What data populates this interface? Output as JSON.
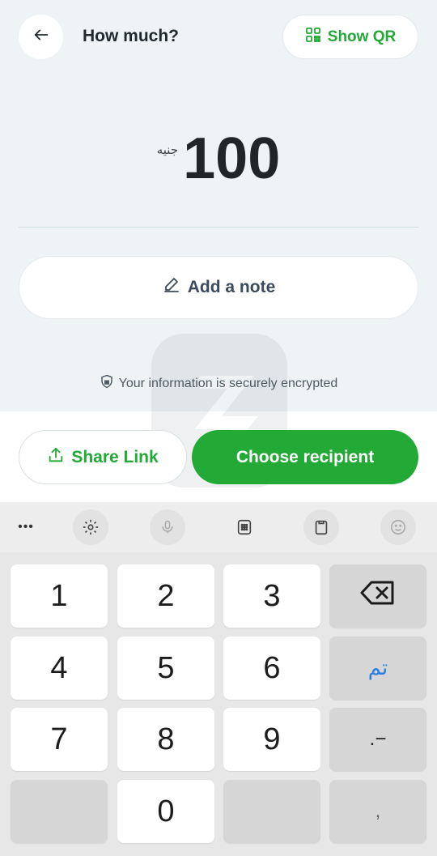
{
  "header": {
    "title": "How much?",
    "show_qr_label": "Show QR"
  },
  "amount": {
    "currency": "جنيه",
    "value": "100"
  },
  "note": {
    "label": "Add a note"
  },
  "security": {
    "text": "Your information is securely encrypted"
  },
  "actions": {
    "share_label": "Share Link",
    "choose_label": "Choose recipient"
  },
  "keyboard": {
    "toolbar_more": "•••",
    "keys": [
      "1",
      "2",
      "3",
      "4",
      "5",
      "6",
      "7",
      "8",
      "9",
      "0"
    ],
    "done_label": "تم",
    "minus_dot_label": ".−",
    "comma_label": ","
  },
  "colors": {
    "accent": "#22a936",
    "background": "#eef3f6"
  }
}
